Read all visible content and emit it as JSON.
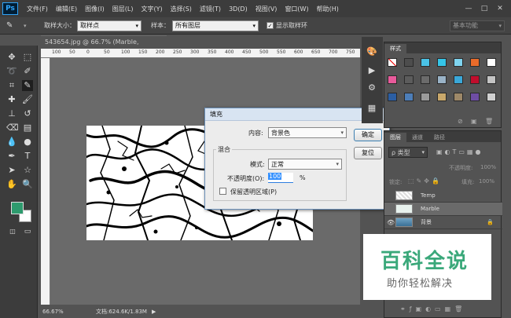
{
  "app": {
    "logo": "Ps"
  },
  "menu": [
    "文件(F)",
    "编辑(E)",
    "图像(I)",
    "图层(L)",
    "文字(Y)",
    "选择(S)",
    "滤镜(T)",
    "3D(D)",
    "视图(V)",
    "窗口(W)",
    "帮助(H)"
  ],
  "window_controls": {
    "minimize": "—",
    "maximize": "□",
    "close": "✕"
  },
  "options": {
    "sample_size_label": "取样大小：",
    "sample_size_value": "取样点",
    "sample_label": "样本：",
    "sample_value": "所有图层",
    "show_ring_label": "显示取样环",
    "workspace": "基本功能"
  },
  "document": {
    "tab_title": "543654.jpg @ 66.7% (Marble, RGB/8#) *",
    "zoom": "66.67%",
    "doc_size": "文档:624.6K/1.83M",
    "ruler_ticks": [
      "100",
      "50",
      "0",
      "50",
      "100",
      "150",
      "200",
      "250",
      "300",
      "350",
      "400",
      "450",
      "500",
      "550",
      "600",
      "650",
      "700",
      "750"
    ]
  },
  "fill_dialog": {
    "title": "填充",
    "content_label": "内容:",
    "content_value": "背景色",
    "blend_label": "混合",
    "mode_label": "模式:",
    "mode_value": "正常",
    "opacity_label": "不透明度(O):",
    "opacity_value": "100",
    "opacity_unit": "%",
    "preserve_label": "保留透明区域(P)",
    "ok_label": "确定",
    "reset_label": "复位"
  },
  "styles_panel": {
    "tab": "样式",
    "swatch_colors": [
      "#ffffff",
      "#4d4d4d",
      "#4ac2e6",
      "#35c5e8",
      "#7fd4ef",
      "#e96b2a",
      "#ffffff",
      "#e85a9b",
      "#5c5c5c",
      "#6b6b6b",
      "#9ab3c7",
      "#3aa8d9",
      "#c00d2c",
      "#c4c4c4",
      "#2b5ea3",
      "#4d7eb8",
      "#9b9b9b",
      "#c9a86b",
      "#9d8868",
      "#6e4da3",
      "#d0d0d0"
    ]
  },
  "layers_panel": {
    "tabs": [
      "图层",
      "通道",
      "路径"
    ],
    "kind_label": "ρ 类型",
    "opacity_label": "不透明度:",
    "opacity_value": "100%",
    "lock_label": "锁定:",
    "fill_label": "填充:",
    "fill_value": "100%",
    "layers": [
      {
        "name": "Temp",
        "visible": false
      },
      {
        "name": "Marble",
        "visible": false
      },
      {
        "name": "背景",
        "visible": true
      }
    ]
  },
  "colors": {
    "foreground": "#2e9b6e",
    "background": "#ffffff",
    "accent": "#31a8ff"
  },
  "watermark": {
    "line1": "百科全说",
    "line2": "助你轻松解决"
  }
}
